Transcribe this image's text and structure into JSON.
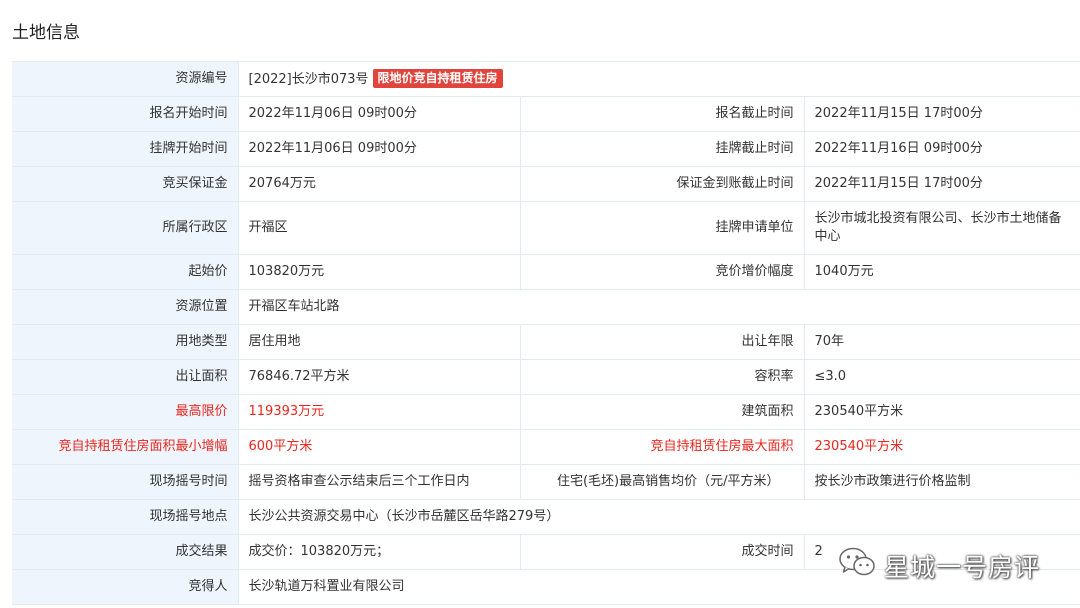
{
  "page": {
    "title": "土地信息"
  },
  "table": {
    "r1": {
      "l1": "资源编号",
      "v1": "[2022]长沙市073号",
      "badge": "限地价竞自持租赁住房"
    },
    "r2": {
      "l1": "报名开始时间",
      "v1": "2022年11月06日 09时00分",
      "l2": "报名截止时间",
      "v2": "2022年11月15日 17时00分"
    },
    "r3": {
      "l1": "挂牌开始时间",
      "v1": "2022年11月06日 09时00分",
      "l2": "挂牌截止时间",
      "v2": "2022年11月16日 09时00分"
    },
    "r4": {
      "l1": "竞买保证金",
      "v1": "20764万元",
      "l2": "保证金到账截止时间",
      "v2": "2022年11月15日 17时00分"
    },
    "r5": {
      "l1": "所属行政区",
      "v1": "开福区",
      "l2": "挂牌申请单位",
      "v2": "长沙市城北投资有限公司、长沙市土地储备中心"
    },
    "r6": {
      "l1": "起始价",
      "v1": "103820万元",
      "l2": "竞价增价幅度",
      "v2": "1040万元"
    },
    "r7": {
      "l1": "资源位置",
      "v1": "开福区车站北路"
    },
    "r8": {
      "l1": "用地类型",
      "v1": "居住用地",
      "l2": "出让年限",
      "v2": "70年"
    },
    "r9": {
      "l1": "出让面积",
      "v1": "76846.72平方米",
      "l2": "容积率",
      "v2": "≤3.0"
    },
    "r10": {
      "l1": "最高限价",
      "v1": "119393万元",
      "l2": "建筑面积",
      "v2": "230540平方米"
    },
    "r11": {
      "l1": "竞自持租赁住房面积最小增幅",
      "v1": "600平方米",
      "l2": "竞自持租赁住房最大面积",
      "v2": "230540平方米"
    },
    "r12": {
      "l1": "现场摇号时间",
      "v1": "摇号资格审查公示结束后三个工作日内",
      "l2": "住宅(毛坯)最高销售均价（元/平方米）",
      "v2": "按长沙市政策进行价格监制"
    },
    "r13": {
      "l1": "现场摇号地点",
      "v1": "长沙公共资源交易中心（长沙市岳麓区岳华路279号）"
    },
    "r14": {
      "l1": "成交结果",
      "v1": "成交价：103820万元；",
      "l2": "成交时间",
      "v2": "2"
    },
    "r15": {
      "l1": "竞得人",
      "v1": "长沙轨道万科置业有限公司"
    }
  },
  "watermark": {
    "text": "星城一号房评",
    "icon": "wechat-icon"
  },
  "colors": {
    "label_bg": "#eef5fc",
    "border": "#e4eaf1",
    "highlight": "#e8271e",
    "badge_bg": "#e0443c"
  }
}
